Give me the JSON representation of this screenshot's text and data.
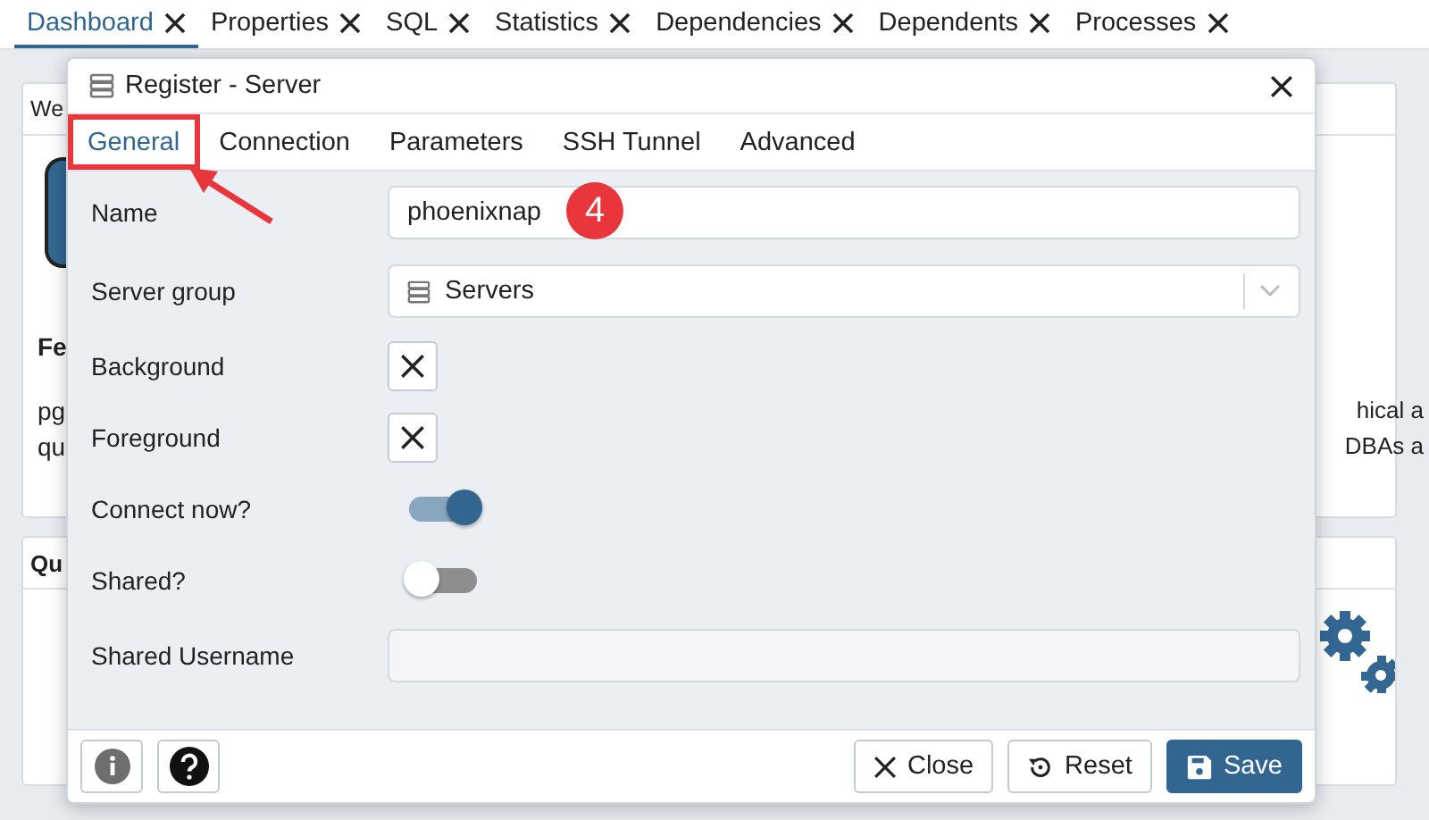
{
  "document_tabs": [
    {
      "label": "Dashboard",
      "selected": true
    },
    {
      "label": "Properties",
      "selected": false
    },
    {
      "label": "SQL",
      "selected": false
    },
    {
      "label": "Statistics",
      "selected": false
    },
    {
      "label": "Dependencies",
      "selected": false
    },
    {
      "label": "Dependents",
      "selected": false
    },
    {
      "label": "Processes",
      "selected": false
    }
  ],
  "background": {
    "panel_1": {
      "title": "We",
      "heading": "Fe",
      "lines": [
        {
          "left": "pg",
          "right": "hical a"
        },
        {
          "left": "qu",
          "right": "DBAs a"
        }
      ]
    },
    "panel_2": {
      "title": "Qu"
    }
  },
  "dialog": {
    "title": "Register - Server",
    "tabs": [
      {
        "label": "General",
        "selected": true,
        "highlighted": true
      },
      {
        "label": "Connection",
        "selected": false,
        "highlighted": false
      },
      {
        "label": "Parameters",
        "selected": false,
        "highlighted": false
      },
      {
        "label": "SSH Tunnel",
        "selected": false,
        "highlighted": false
      },
      {
        "label": "Advanced",
        "selected": false,
        "highlighted": false
      }
    ],
    "fields": [
      {
        "kind": "text",
        "label": "Name",
        "value": "phoenixnap",
        "disabled": false
      },
      {
        "kind": "select",
        "label": "Server group",
        "value": "Servers"
      },
      {
        "kind": "color",
        "label": "Background"
      },
      {
        "kind": "color",
        "label": "Foreground"
      },
      {
        "kind": "switch",
        "label": "Connect now?",
        "on": true
      },
      {
        "kind": "switch",
        "label": "Shared?",
        "on": false
      },
      {
        "kind": "text",
        "label": "Shared Username",
        "disabled": true
      }
    ],
    "buttons": [
      {
        "kind": "close",
        "label": "Close"
      },
      {
        "kind": "reset",
        "label": "Reset"
      },
      {
        "kind": "save",
        "label": "Save"
      }
    ],
    "step_badge": "4"
  }
}
